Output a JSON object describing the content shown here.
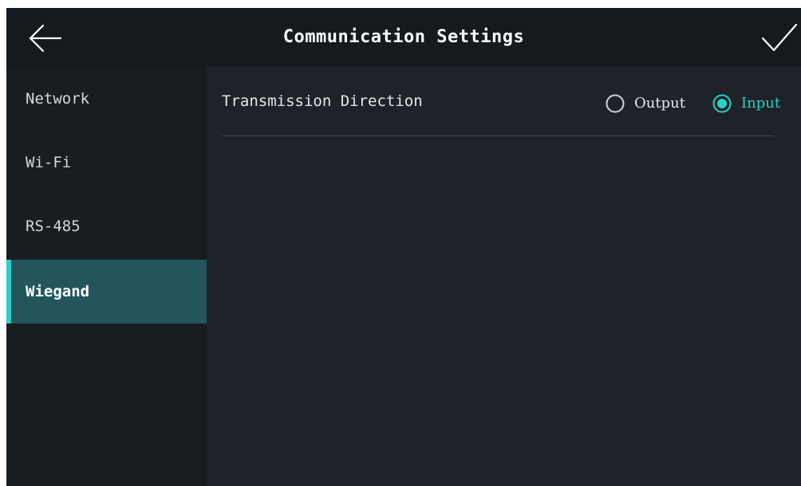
{
  "header": {
    "title": "Communication Settings",
    "back_icon": "arrow-left-icon",
    "confirm_icon": "checkmark-icon"
  },
  "sidebar": {
    "items": [
      {
        "label": "Network",
        "active": false
      },
      {
        "label": "Wi-Fi",
        "active": false
      },
      {
        "label": "RS-485",
        "active": false
      },
      {
        "label": "Wiegand",
        "active": true
      }
    ]
  },
  "main": {
    "transmission_direction": {
      "label": "Transmission Direction",
      "options": [
        {
          "label": "Output",
          "selected": false
        },
        {
          "label": "Input",
          "selected": true
        }
      ]
    }
  },
  "colors": {
    "accent": "#2ad1c6",
    "active_item_bg": "#24555d",
    "header_bg": "#151a1f",
    "sidebar_bg": "#181d22",
    "content_bg": "#1e2329"
  }
}
